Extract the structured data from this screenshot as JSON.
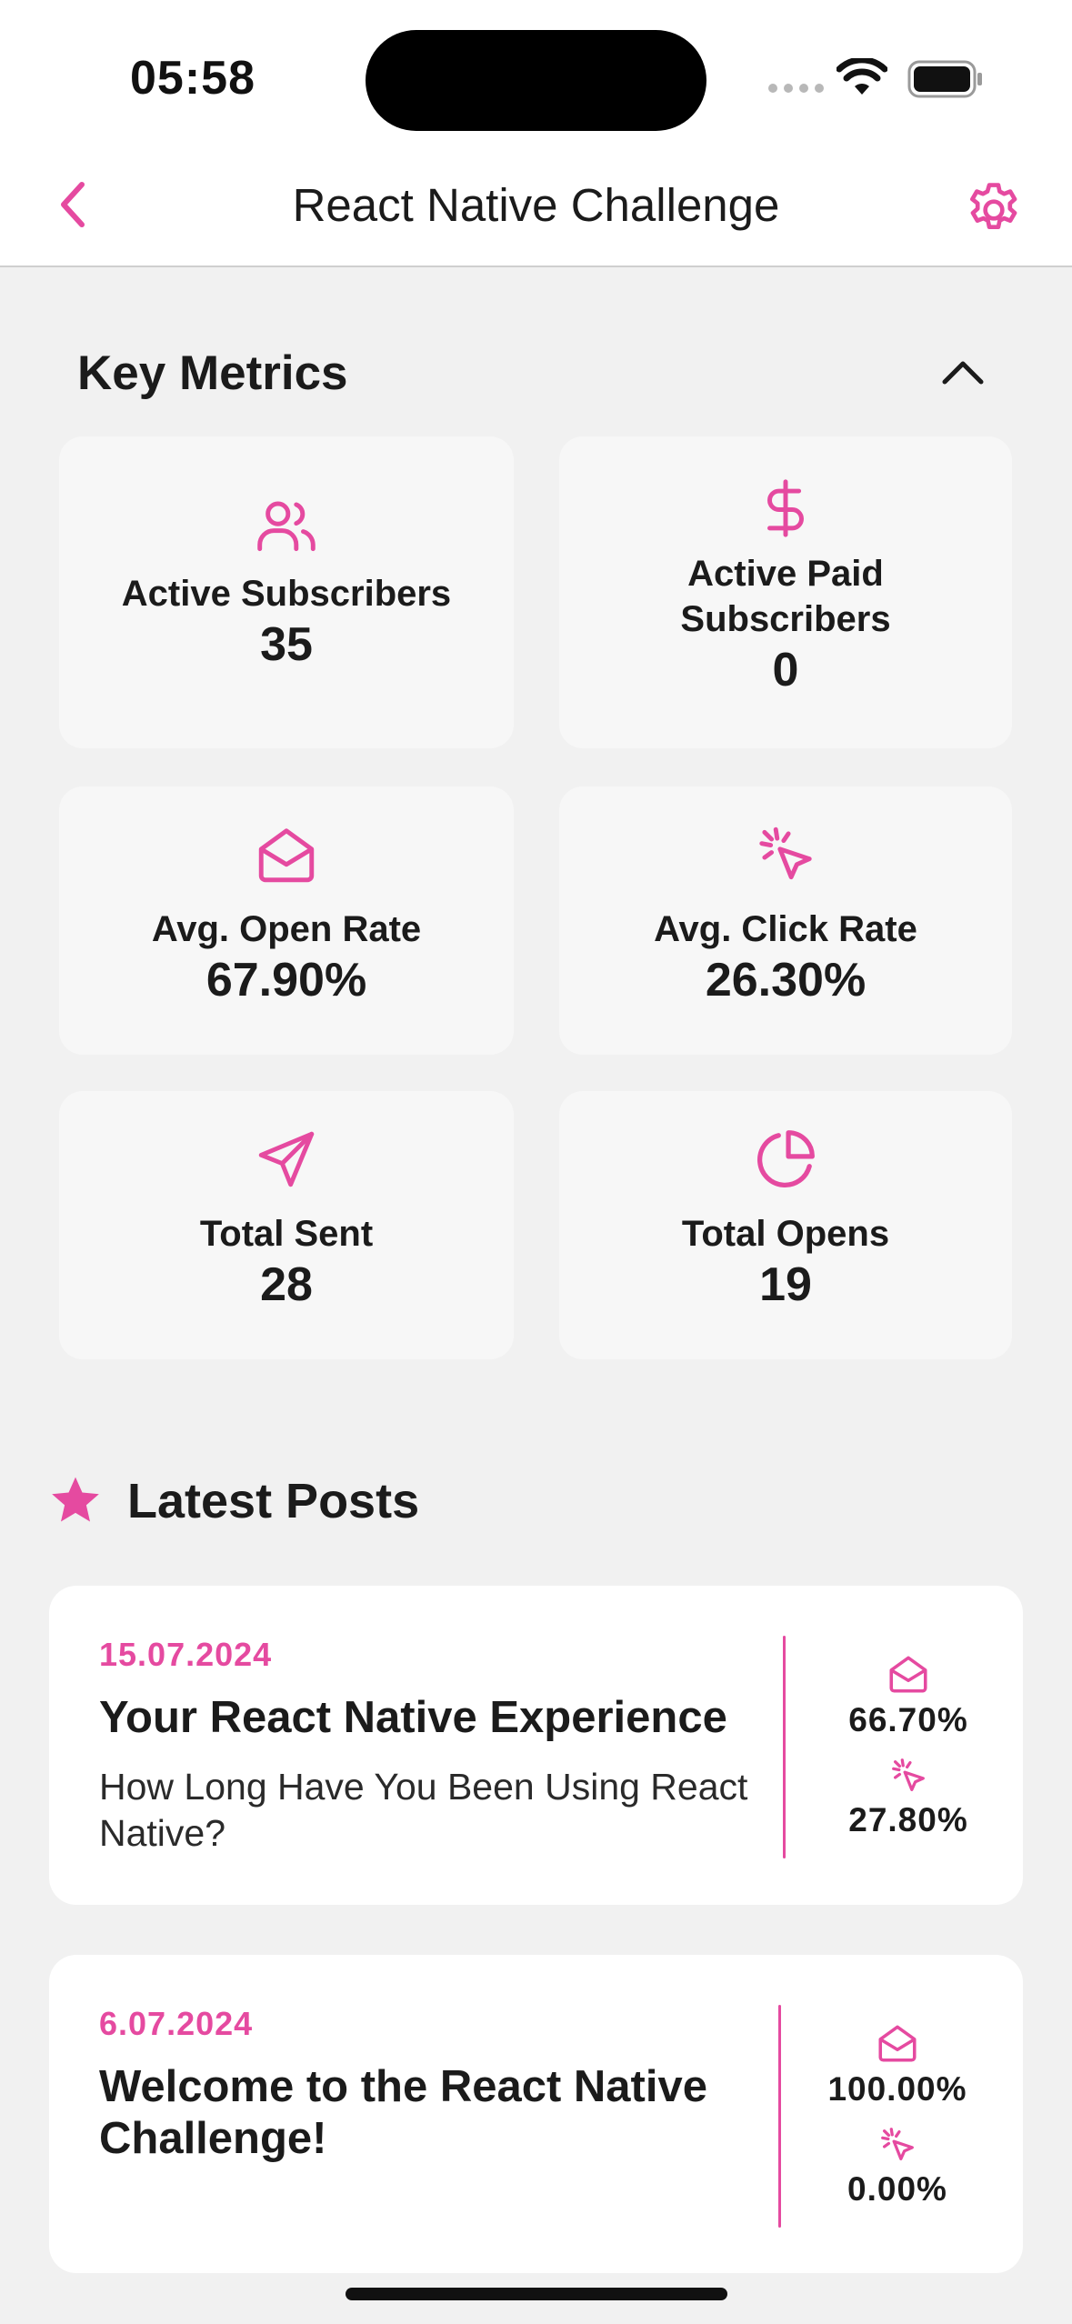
{
  "status_bar": {
    "time": "05:58"
  },
  "nav": {
    "title": "React Native Challenge",
    "back_icon": "chevron-left-icon",
    "settings_icon": "gear-icon"
  },
  "colors": {
    "accent": "#e54aa0",
    "background": "#f1f1f1",
    "card": "#f7f7f7",
    "text": "#1b1b1b"
  },
  "key_metrics": {
    "title": "Key Metrics",
    "toggle_icon": "chevron-up-icon",
    "cards": [
      {
        "icon": "users-icon",
        "label": "Active Subscribers",
        "value": "35"
      },
      {
        "icon": "dollar-icon",
        "label": "Active Paid Subscribers",
        "value": "0"
      },
      {
        "icon": "envelope-open-icon",
        "label": "Avg. Open Rate",
        "value": "67.90%"
      },
      {
        "icon": "cursor-click-icon",
        "label": "Avg. Click Rate",
        "value": "26.30%"
      },
      {
        "icon": "send-icon",
        "label": "Total Sent",
        "value": "28"
      },
      {
        "icon": "pie-chart-icon",
        "label": "Total Opens",
        "value": "19"
      }
    ]
  },
  "latest_posts": {
    "title": "Latest Posts",
    "icon": "star-icon",
    "posts": [
      {
        "date": "15.07.2024",
        "title": "Your React Native Experience",
        "subtitle": "How Long Have You Been Using React Native?",
        "open_rate": "66.70%",
        "click_rate": "27.80%"
      },
      {
        "date": "6.07.2024",
        "title": "Welcome to the React Native Challenge!",
        "subtitle": "",
        "open_rate": "100.00%",
        "click_rate": "0.00%"
      }
    ]
  }
}
